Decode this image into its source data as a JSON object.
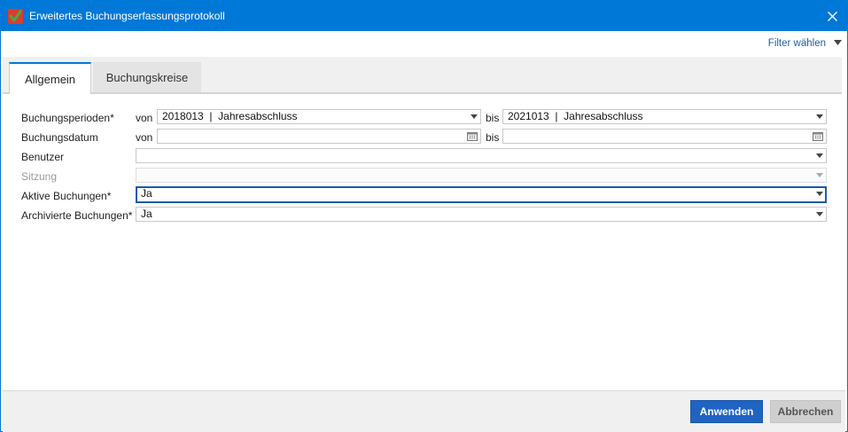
{
  "window": {
    "title": "Erweitertes Buchungserfassungsprotokoll"
  },
  "toolbar": {
    "filter_label": "Filter wählen"
  },
  "tabs": [
    {
      "label": "Allgemein",
      "active": true
    },
    {
      "label": "Buchungskreise",
      "active": false
    }
  ],
  "form": {
    "von_label": "von",
    "bis_label": "bis",
    "buchungsperioden": {
      "label": "Buchungsperioden*",
      "from_value": "2018013  |  Jahresabschluss",
      "to_value": "2021013  |  Jahresabschluss"
    },
    "buchungsdatum": {
      "label": "Buchungsdatum",
      "from_value": "",
      "to_value": ""
    },
    "benutzer": {
      "label": "Benutzer",
      "value": ""
    },
    "sitzung": {
      "label": "Sitzung",
      "value": ""
    },
    "aktive_buchungen": {
      "label": "Aktive Buchungen*",
      "value": "Ja"
    },
    "archivierte_buchungen": {
      "label": "Archivierte Buchungen*",
      "value": "Ja"
    }
  },
  "footer": {
    "apply_label": "Anwenden",
    "cancel_label": "Abbrechen"
  },
  "colors": {
    "accent": "#0078d7",
    "primary_button": "#1f64c2",
    "focus_border": "#1a5ba6"
  }
}
